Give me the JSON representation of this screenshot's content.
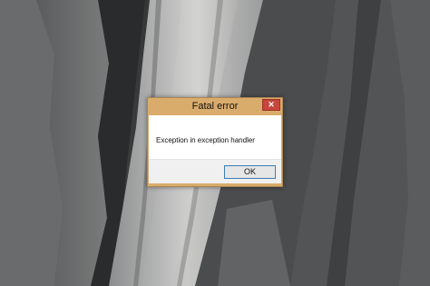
{
  "dialog": {
    "title": "Fatal error",
    "close_label": "✕",
    "message": "Exception in exception handler",
    "ok_label": "OK"
  },
  "colors": {
    "frame": "#d9ac6c",
    "close_button": "#c7463c",
    "button_bar": "#f0f0f0",
    "ok_border": "#3c7fb1"
  },
  "icons": {
    "close": "close-icon"
  }
}
